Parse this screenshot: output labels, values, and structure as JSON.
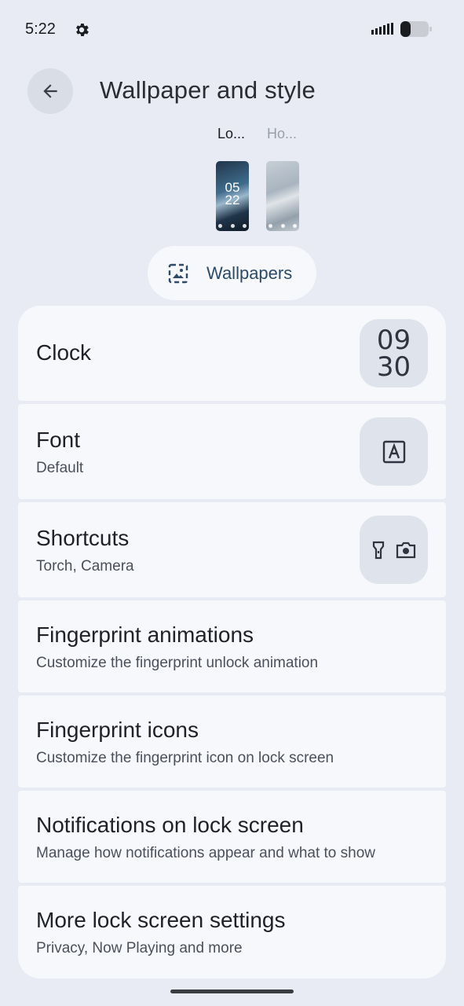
{
  "status_bar": {
    "time": "5:22",
    "icons": [
      "gear-icon",
      "signal-icon",
      "battery-icon"
    ]
  },
  "header": {
    "title": "Wallpaper and style",
    "back_icon": "arrow-back-icon"
  },
  "tabs": [
    {
      "label": "Lo..."
    },
    {
      "label": "Ho..."
    }
  ],
  "lock_preview": {
    "clock": "05\n22"
  },
  "wallpapers_button": {
    "label": "Wallpapers",
    "icon": "image-icon"
  },
  "settings": [
    {
      "title": "Clock",
      "subtitle": "",
      "thumb": "09\n30"
    },
    {
      "title": "Font",
      "subtitle": "Default",
      "thumb_icon": "font-a-icon"
    },
    {
      "title": "Shortcuts",
      "subtitle": "Torch, Camera",
      "thumb_icons": [
        "torch-icon",
        "camera-icon"
      ]
    },
    {
      "title": "Fingerprint animations",
      "subtitle": "Customize the fingerprint unlock animation"
    },
    {
      "title": "Fingerprint icons",
      "subtitle": "Customize the fingerprint icon on lock screen"
    },
    {
      "title": "Notifications on lock screen",
      "subtitle": "Manage how notifications appear and what to show"
    },
    {
      "title": "More lock screen settings",
      "subtitle": "Privacy, Now Playing and more"
    }
  ],
  "colors": {
    "background": "#e8ebf3",
    "card": "#f6f8fc",
    "accent": "#2d4b69"
  }
}
